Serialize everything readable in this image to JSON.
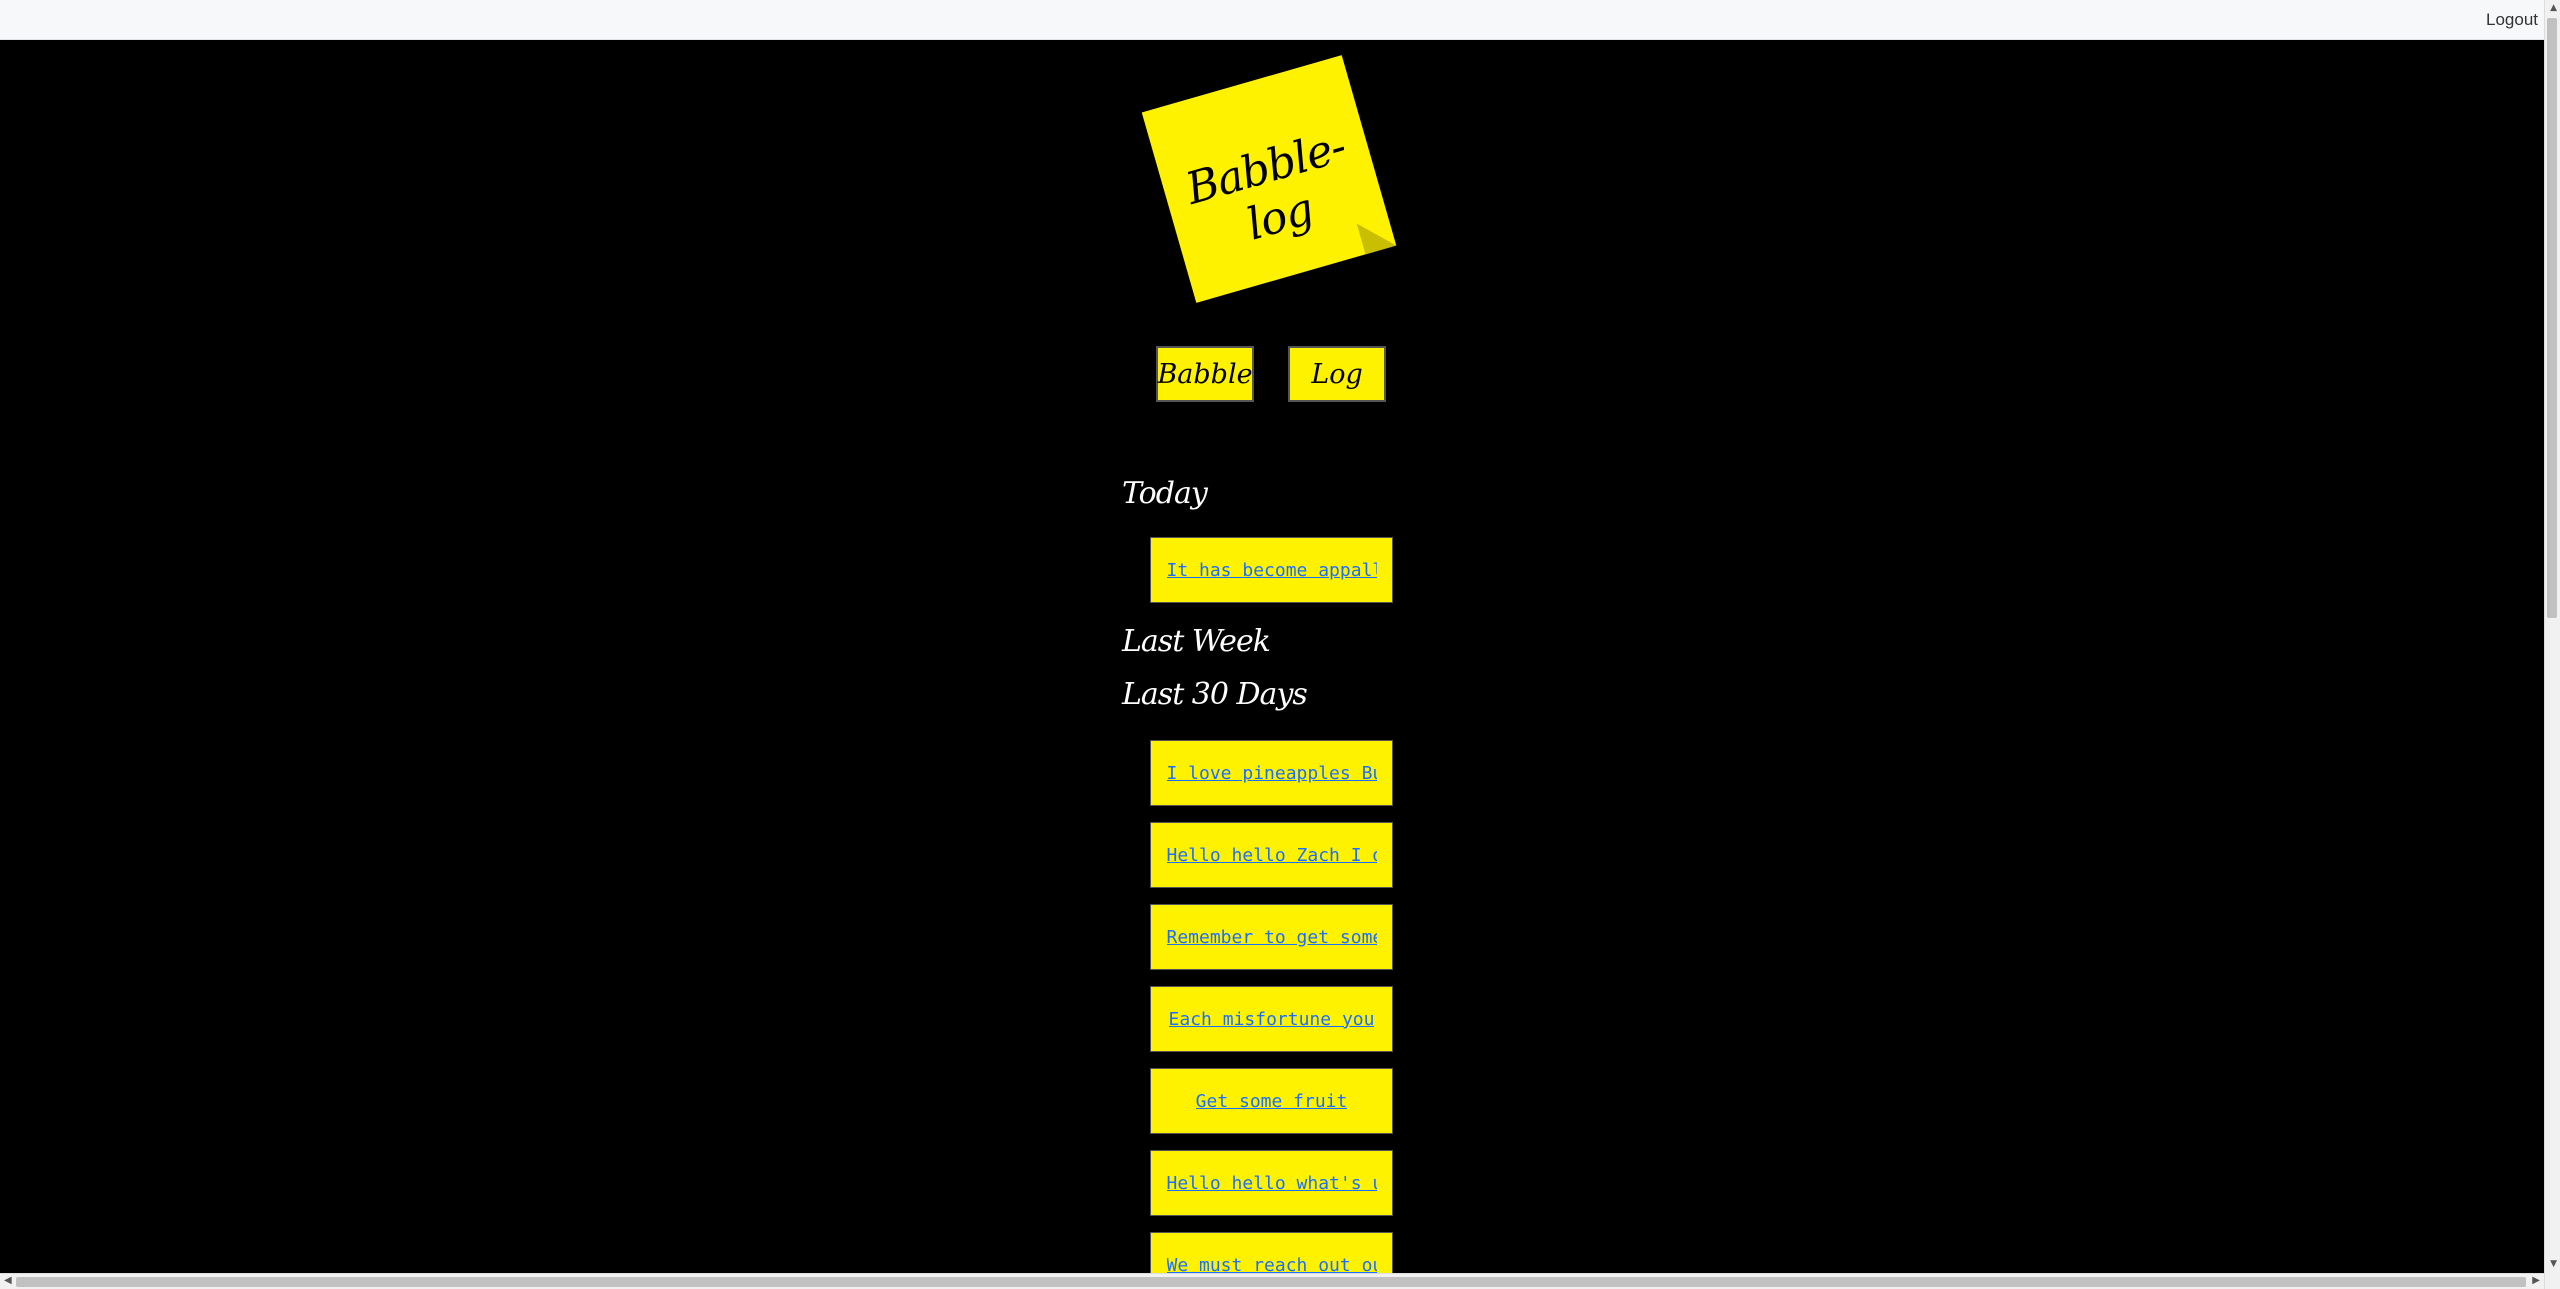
{
  "header": {
    "logout_label": "Logout"
  },
  "logo": {
    "title": "Babble-log"
  },
  "nav": {
    "babble_label": "Babble",
    "log_label": "Log"
  },
  "sections": {
    "today": "Today",
    "last_week": "Last Week",
    "last_30_days": "Last 30 Days"
  },
  "today_entries": [
    "It has become appall"
  ],
  "last_30_entries": [
    "I love pineapples Bu",
    "Hello hello Zach I d",
    "Remember to get some",
    "Each misfortune you",
    "Get some fruit",
    "Hello hello what's u",
    "We must reach out ou"
  ],
  "colors": {
    "note_yellow": "#fff200",
    "background": "#000000",
    "link": "#1a6fff"
  }
}
